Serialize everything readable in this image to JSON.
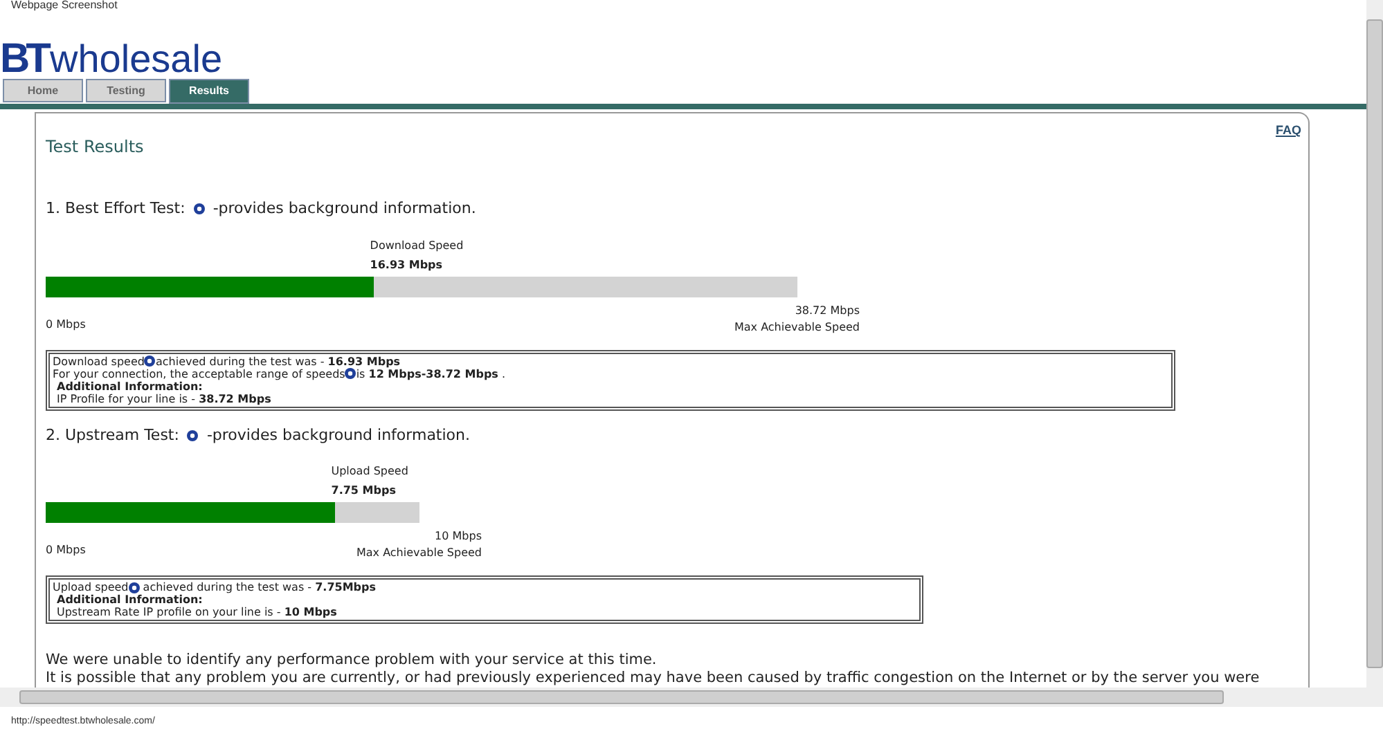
{
  "caption": "Webpage Screenshot",
  "logo": {
    "mark": "BT",
    "word": "wholesale"
  },
  "tabs": [
    {
      "label": "Home",
      "selected": false
    },
    {
      "label": "Testing",
      "selected": false
    },
    {
      "label": "Results",
      "selected": true
    }
  ],
  "panel": {
    "title": "Test Results",
    "faq": "FAQ"
  },
  "tests": [
    {
      "kind": "download",
      "heading": "1. Best Effort Test:",
      "info": "-provides background information.",
      "speed_label": "Download Speed",
      "speed": "16.93 Mbps",
      "level": 0.437,
      "min": "0 Mbps",
      "max": "38.72 Mbps",
      "max_label": "Max Achievable Speed",
      "details": [
        {
          "kind": "help",
          "before": "Download speed",
          "after": "achieved during the test was - **16.93 Mbps**"
        },
        {
          "kind": "help",
          "before": "For your connection, the acceptable range of speeds",
          "after": "is **12 Mbps-38.72 Mbps** ."
        },
        {
          "kind": "bold",
          "text": "Additional Information:"
        },
        {
          "kind": "plain",
          "text": "IP Profile for your line is - **38.72 Mbps**"
        }
      ]
    },
    {
      "kind": "upload",
      "heading": "2. Upstream Test:",
      "info": "-provides background information.",
      "speed_label": "Upload Speed",
      "speed": "7.75 Mbps",
      "level": 0.775,
      "min": "0 Mbps",
      "max": "10 Mbps",
      "max_label": "Max Achievable Speed",
      "details": [
        {
          "kind": "help",
          "before": "Upload speed",
          "after": " achieved during the test was - **7.75Mbps**"
        },
        {
          "kind": "bold",
          "text": "Additional Information:"
        },
        {
          "kind": "plain",
          "text": "Upstream Rate IP profile on your line is - **10 Mbps**"
        }
      ]
    }
  ],
  "message": [
    "We were unable to identify any performance problem with your service at this time.",
    "It is possible that any problem you are currently, or had previously experienced may have been caused by traffic congestion on the Internet or by the server you were"
  ],
  "status_bar": "http://speedtest.btwholesale.com/"
}
